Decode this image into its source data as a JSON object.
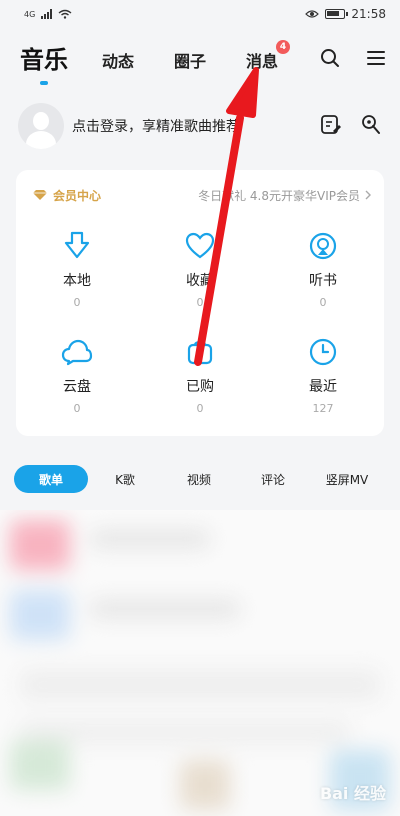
{
  "statusbar": {
    "network": "4G",
    "time": "21:58"
  },
  "nav": {
    "main": "音乐",
    "tabs": [
      "动态",
      "圈子",
      "消息"
    ],
    "message_badge": "4"
  },
  "login": {
    "prompt": "点击登录，享精准歌曲推荐"
  },
  "member": {
    "title": "会员中心",
    "promo": "冬日献礼  4.8元开豪华VIP会员",
    "accent_color": "#d6a44a",
    "items": [
      {
        "label": "本地",
        "count": "0",
        "icon": "download-icon"
      },
      {
        "label": "收藏",
        "count": "0",
        "icon": "heart-icon"
      },
      {
        "label": "听书",
        "count": "0",
        "icon": "audiobook-icon"
      },
      {
        "label": "云盘",
        "count": "0",
        "icon": "cloud-icon"
      },
      {
        "label": "已购",
        "count": "0",
        "icon": "purchased-bag-icon"
      },
      {
        "label": "最近",
        "count": "127",
        "icon": "clock-icon"
      }
    ]
  },
  "segments": [
    "歌单",
    "K歌",
    "视频",
    "评论",
    "竖屏MV"
  ],
  "colors": {
    "accent": "#1aa3e8",
    "arrow": "#e8191e",
    "badge": "#f25b5b"
  },
  "watermark": "Bai 经验"
}
